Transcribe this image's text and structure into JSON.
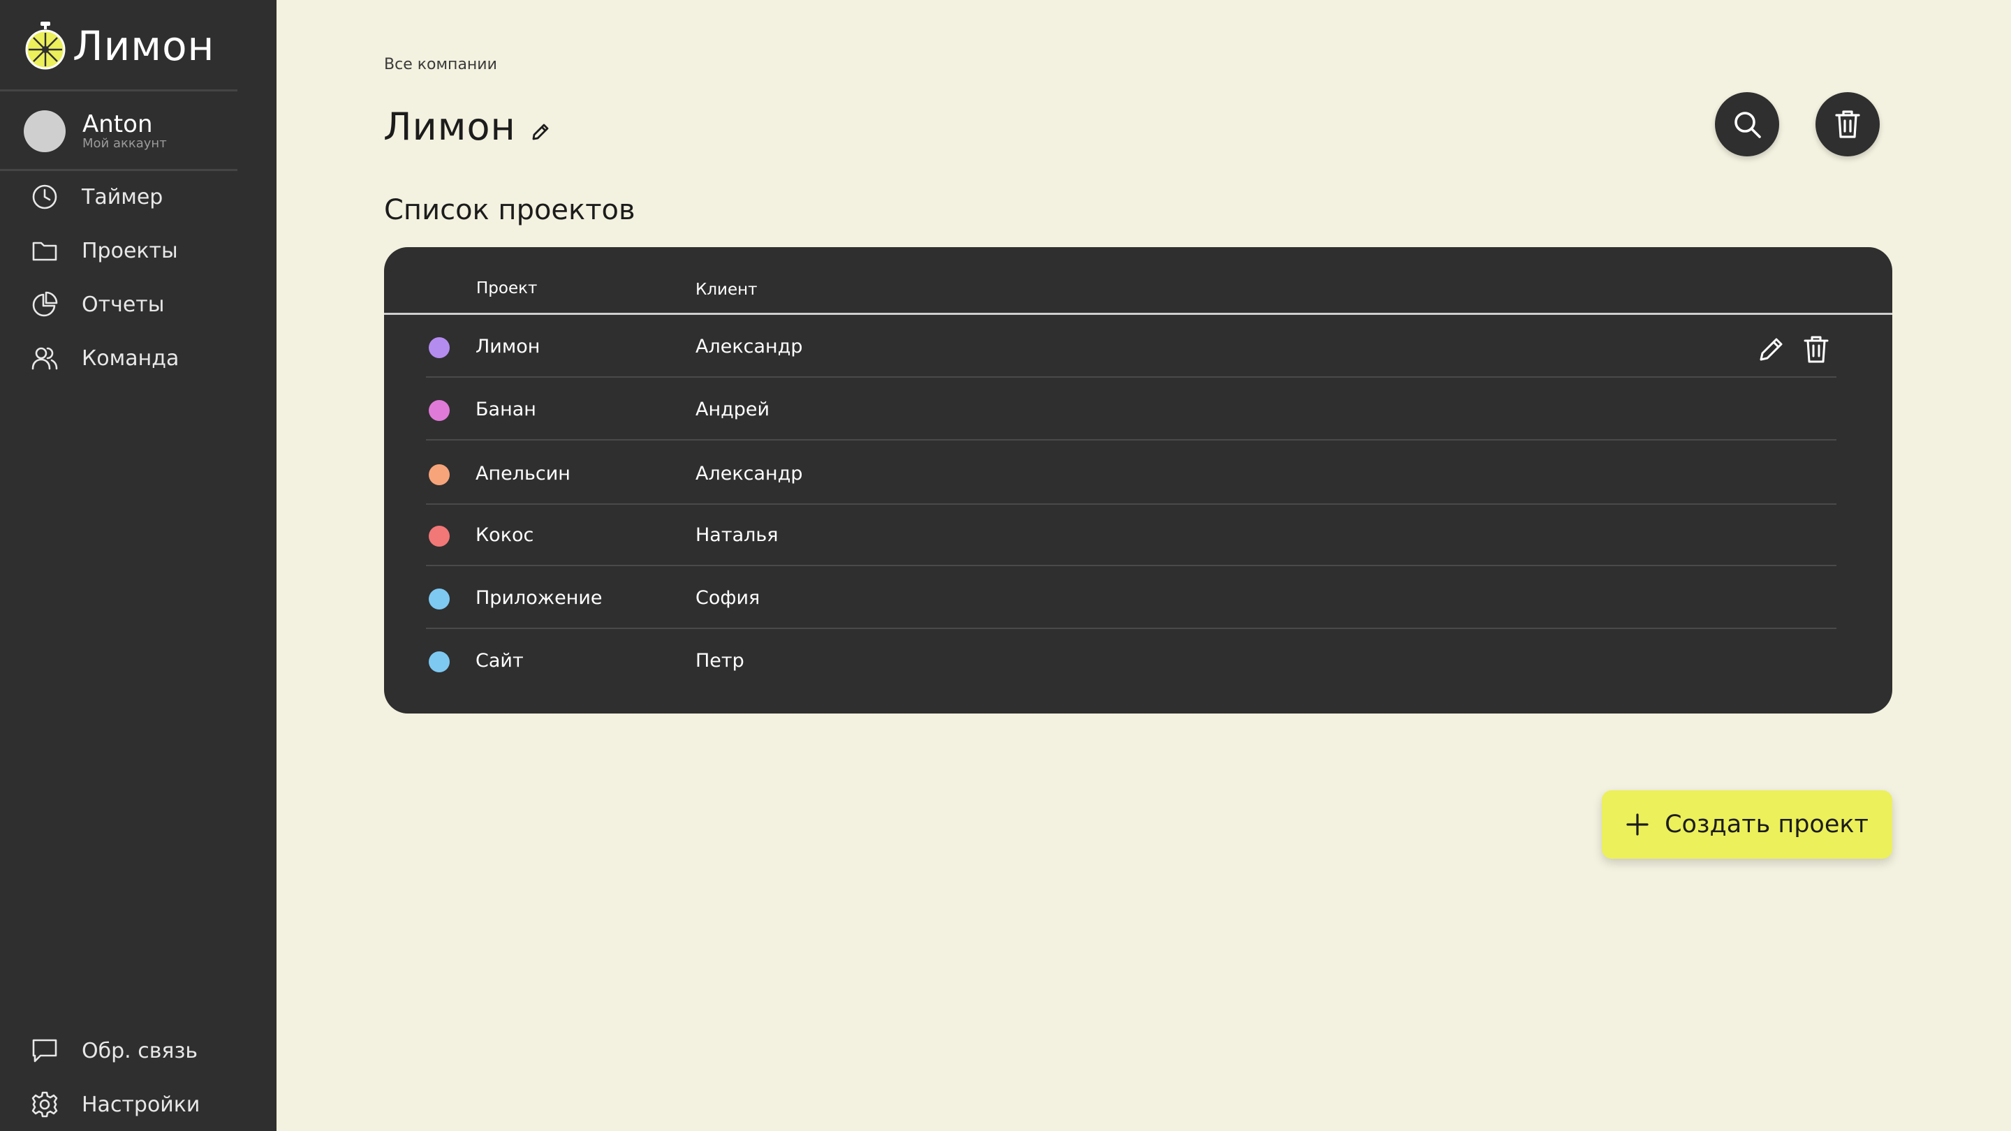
{
  "app": {
    "name": "Лимон",
    "accent": "#ecf05a"
  },
  "account": {
    "name": "Anton",
    "subtitle": "Мой аккаунт"
  },
  "nav": {
    "items": [
      {
        "label": "Таймер",
        "icon": "clock-icon"
      },
      {
        "label": "Проекты",
        "icon": "folder-icon"
      },
      {
        "label": "Отчеты",
        "icon": "pie-chart-icon"
      },
      {
        "label": "Команда",
        "icon": "team-icon"
      }
    ],
    "bottom": [
      {
        "label": "Обр. связь",
        "icon": "chat-icon"
      },
      {
        "label": "Настройки",
        "icon": "gear-icon"
      }
    ]
  },
  "main": {
    "breadcrumb": "Все компании",
    "title": "Лимон",
    "section_title": "Список проектов",
    "table": {
      "columns": [
        "Проект",
        "Клиент"
      ],
      "rows": [
        {
          "project": "Лимон",
          "client": "Александр",
          "color": "#b48cf0"
        },
        {
          "project": "Банан",
          "client": "Андрей",
          "color": "#e07ad8"
        },
        {
          "project": "Апельсин",
          "client": "Александр",
          "color": "#f7a47a"
        },
        {
          "project": "Кокос",
          "client": "Наталья",
          "color": "#f27777"
        },
        {
          "project": "Приложение",
          "client": "София",
          "color": "#7ec9f2"
        },
        {
          "project": "Сайт",
          "client": "Петр",
          "color": "#7ec9f2"
        }
      ]
    },
    "create_label": "Создать проект"
  }
}
